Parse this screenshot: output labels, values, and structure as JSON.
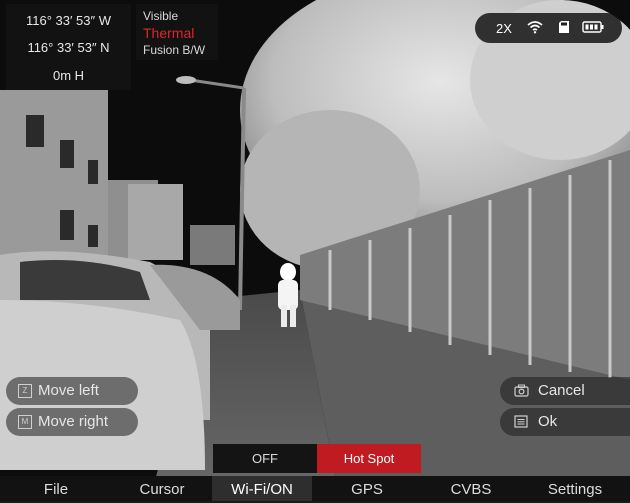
{
  "gps": {
    "longitude": "116° 33′ 53″ W",
    "latitude": "116° 33′ 53″ N",
    "altitude": "0m H"
  },
  "modes": {
    "visible": "Visible",
    "thermal": "Thermal",
    "fusion": "Fusion B/W",
    "active": "thermal"
  },
  "status": {
    "zoom": "2X",
    "icons": [
      "wifi-icon",
      "sd-card-icon",
      "battery-icon"
    ]
  },
  "controls": {
    "move_left": {
      "label": "Move left",
      "key": "Z"
    },
    "move_right": {
      "label": "Move right",
      "key": "M"
    },
    "cancel": {
      "label": "Cancel",
      "icon": "camera-icon"
    },
    "ok": {
      "label": "Ok",
      "icon": "list-icon"
    }
  },
  "toggle": {
    "off_label": "OFF",
    "on_label": "Hot Spot",
    "selected": "Hot Spot",
    "selected_color": "#c11b22"
  },
  "menu": {
    "items": [
      {
        "label": "File"
      },
      {
        "label": "Cursor"
      },
      {
        "label": "Wi-Fi/ON"
      },
      {
        "label": "GPS"
      },
      {
        "label": "CVBS"
      },
      {
        "label": "Settings"
      }
    ],
    "active_index": 2
  },
  "colors": {
    "accent_red": "#e0252b",
    "overlay_bg": "#141414"
  }
}
